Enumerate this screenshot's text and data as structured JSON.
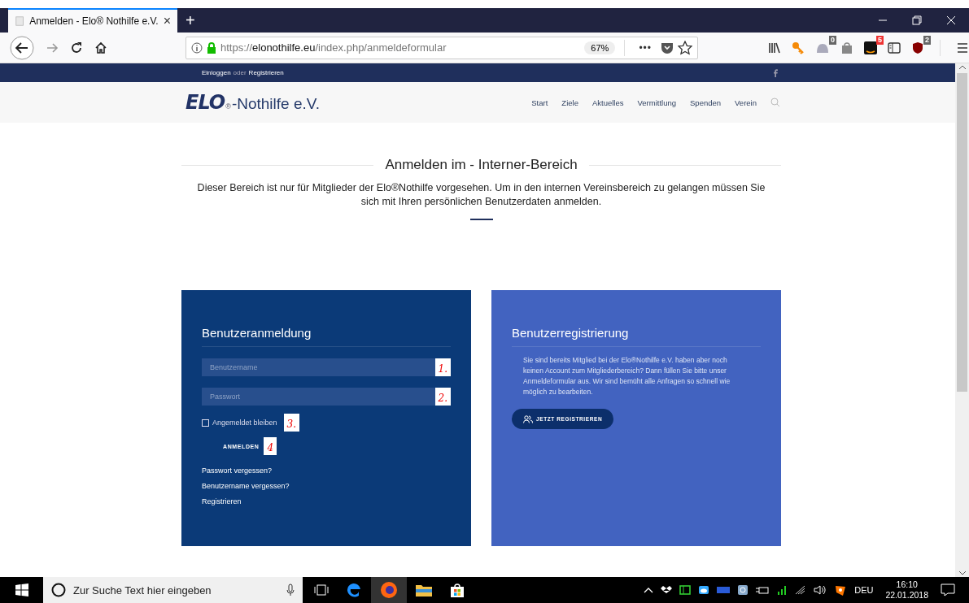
{
  "browser": {
    "tab": {
      "title": "Anmelden - Elo® Nothilfe e.V.",
      "close": "×",
      "selected": true
    },
    "new_tab": "+",
    "url_scheme": "https://",
    "url_host": "elonothilfe.eu",
    "url_path": "/index.php/anmeldeformular",
    "zoom": "67%",
    "more": "•••",
    "badges": [
      "0",
      "5",
      "2"
    ]
  },
  "site": {
    "topbar": {
      "login": "Einloggen",
      "conjunction": "oder",
      "register": "Registrieren"
    },
    "logo": {
      "mark": "ELO",
      "registered": "®",
      "name": "-Nothilfe e.V."
    },
    "nav": [
      "Start",
      "Ziele",
      "Aktuelles",
      "Vermittlung",
      "Spenden",
      "Verein"
    ],
    "intro": {
      "title": "Anmelden im - Interner-Bereich",
      "text": "Dieser Bereich ist nur für Mitglieder der Elo®Nothilfe vorgesehen. Um in den internen Vereinsbereich zu gelangen müssen Sie sich mit Ihren persönlichen Benutzerdaten anmelden."
    },
    "login": {
      "title": "Benutzeranmeldung",
      "fields": [
        {
          "placeholder": "Benutzername",
          "note": "1."
        },
        {
          "placeholder": "Passwort",
          "note": "2."
        }
      ],
      "remember": {
        "label": "Angemeldet bleiben",
        "checked": false,
        "note": "3."
      },
      "button": "ANMELDEN",
      "button_note": "4",
      "links": [
        "Passwort vergessen?",
        "Benutzername vergessen?",
        "Registrieren"
      ]
    },
    "register": {
      "title": "Benutzerregistrierung",
      "text": "Sie sind bereits Mitglied bei der Elo®Nothilfe e.V. haben aber noch keinen Account zum Mitgliederbereich? Dann füllen Sie bitte unser Anmeldeformular aus. Wir sind bemüht alle Anfragen so schnell wie möglich zu bearbeiten.",
      "button": "JETZT REGISTRIEREN"
    }
  },
  "taskbar": {
    "search_placeholder": "Zur Suche Text hier eingeben",
    "language": "DEU",
    "time": "16:10",
    "date": "22.01.2018"
  }
}
